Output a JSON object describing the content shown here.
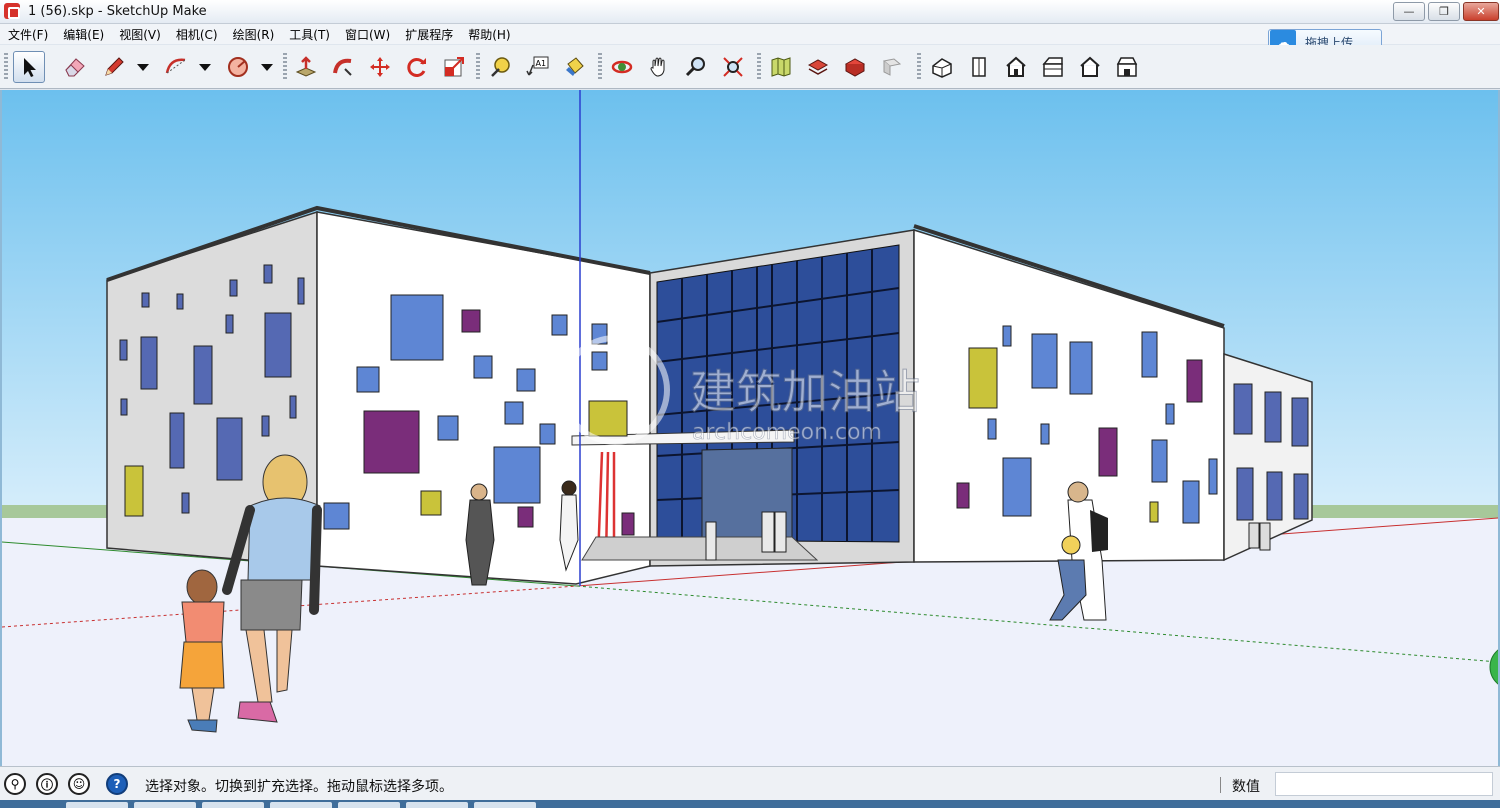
{
  "window": {
    "title": "1 (56).skp - SketchUp Make",
    "controls": {
      "minimize": "—",
      "maximize": "❐",
      "close": "✕"
    }
  },
  "menu": [
    "文件(F)",
    "编辑(E)",
    "视图(V)",
    "相机(C)",
    "绘图(R)",
    "工具(T)",
    "窗口(W)",
    "扩展程序",
    "帮助(H)"
  ],
  "upload_button": {
    "label": "拖拽上传",
    "icon": "cloud-upload-icon"
  },
  "toolbar": {
    "tools": [
      "select",
      "eraser",
      "pencil-line",
      "arc",
      "shape",
      "push-pull",
      "follow-me",
      "move",
      "rotate",
      "scale",
      "tape-measure",
      "text",
      "paint-bucket",
      "orbit",
      "pan",
      "zoom",
      "zoom-extents",
      "warehouse",
      "share-model",
      "extension-warehouse",
      "send-to-layout",
      "iso-view",
      "top-view",
      "front-view",
      "right-view",
      "back-view",
      "left-view"
    ],
    "text_tool_label": "A1"
  },
  "scene": {
    "watermark_main": "建筑加油站",
    "watermark_sub": "archcomeon.com",
    "colors": {
      "sky_top": "#6cc0ee",
      "sky_bottom": "#d7eefb",
      "ground": "#eef1fb"
    }
  },
  "status": {
    "message": "选择对象。切换到扩充选择。拖动鼠标选择多项。",
    "measure_label": "数值",
    "measure_value": ""
  }
}
